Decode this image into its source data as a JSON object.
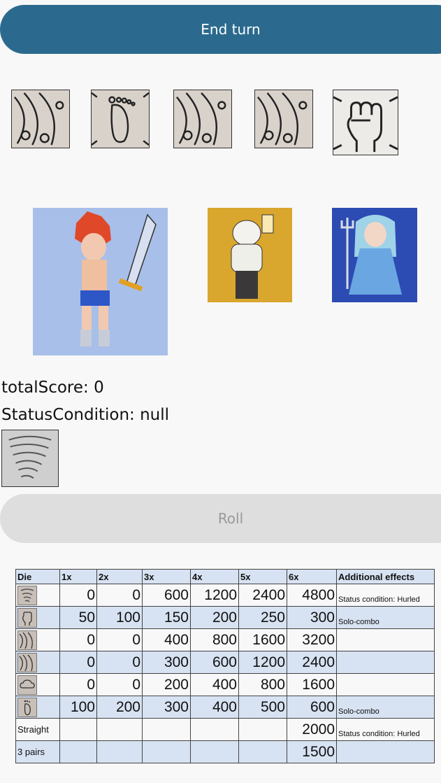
{
  "header": {
    "end_turn_label": "End turn"
  },
  "dice": [
    {
      "icon": "wind-swirl-icon"
    },
    {
      "icon": "foot-icon"
    },
    {
      "icon": "wind-swirl-icon"
    },
    {
      "icon": "wind-swirl-icon"
    },
    {
      "icon": "fist-icon"
    }
  ],
  "characters": [
    {
      "icon": "hero-swordsman-portrait"
    },
    {
      "icon": "brute-with-lantern-portrait"
    },
    {
      "icon": "sea-princess-trident-portrait"
    }
  ],
  "stats": {
    "total_score": "totalScore: 0",
    "status_condition": "StatusCondition: null"
  },
  "roll_label": "Roll",
  "table": {
    "headers": [
      "Die",
      "1x",
      "2x",
      "3x",
      "4x",
      "5x",
      "6x",
      "Additional effects"
    ],
    "rows": [
      {
        "die": "tornado-icon",
        "values": [
          "0",
          "0",
          "600",
          "1200",
          "2400",
          "4800"
        ],
        "effect": "Status condition: Hurled"
      },
      {
        "die": "fist-icon",
        "values": [
          "50",
          "100",
          "150",
          "200",
          "250",
          "300"
        ],
        "effect": "Solo-combo"
      },
      {
        "die": "wind-swirl-icon",
        "values": [
          "0",
          "0",
          "400",
          "800",
          "1600",
          "3200"
        ],
        "effect": ""
      },
      {
        "die": "wind-swirl-icon",
        "values": [
          "0",
          "0",
          "300",
          "600",
          "1200",
          "2400"
        ],
        "effect": ""
      },
      {
        "die": "cloud-icon",
        "values": [
          "0",
          "0",
          "200",
          "400",
          "800",
          "1600"
        ],
        "effect": ""
      },
      {
        "die": "foot-icon",
        "values": [
          "100",
          "200",
          "300",
          "400",
          "500",
          "600"
        ],
        "effect": "Solo-combo"
      },
      {
        "label": "Straight",
        "values": [
          "",
          "",
          "",
          "",
          "",
          "2000"
        ],
        "effect": "Status condition: Hurled"
      },
      {
        "label": "3 pairs",
        "values": [
          "",
          "",
          "",
          "",
          "",
          "1500"
        ],
        "effect": ""
      }
    ]
  }
}
